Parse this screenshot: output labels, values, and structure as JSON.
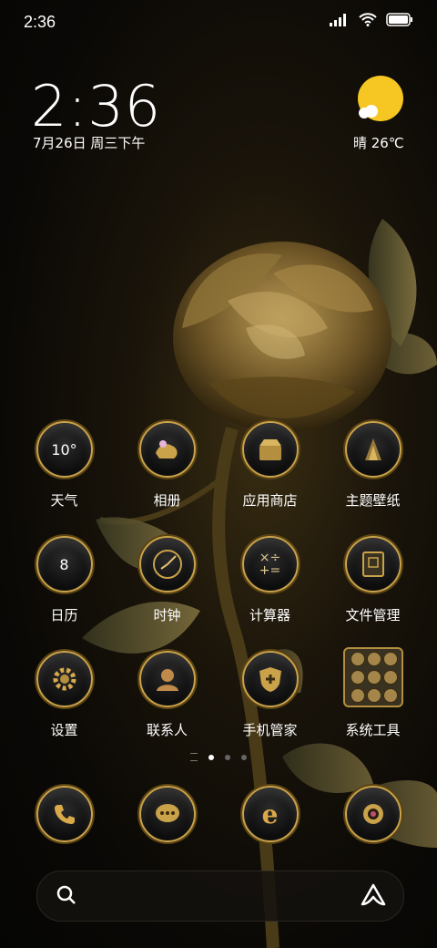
{
  "status_bar": {
    "time": "2:36"
  },
  "clock": {
    "time": "2:36",
    "date": "7月26日 周三下午"
  },
  "weather": {
    "text": "晴 26℃"
  },
  "apps": [
    {
      "label": "天气",
      "icon": "weather-icon",
      "badge": "10°"
    },
    {
      "label": "相册",
      "icon": "gallery-icon"
    },
    {
      "label": "应用商店",
      "icon": "app-store-icon"
    },
    {
      "label": "主题壁纸",
      "icon": "themes-icon"
    },
    {
      "label": "日历",
      "icon": "calendar-icon",
      "badge": "8"
    },
    {
      "label": "时钟",
      "icon": "clock-icon"
    },
    {
      "label": "计算器",
      "icon": "calculator-icon"
    },
    {
      "label": "文件管理",
      "icon": "file-manager-icon"
    },
    {
      "label": "设置",
      "icon": "settings-icon"
    },
    {
      "label": "联系人",
      "icon": "contacts-icon"
    },
    {
      "label": "手机管家",
      "icon": "security-icon"
    },
    {
      "label": "系统工具",
      "icon": "system-tools-folder-icon"
    }
  ],
  "dock": [
    {
      "icon": "phone-icon"
    },
    {
      "icon": "messages-icon"
    },
    {
      "icon": "browser-icon"
    },
    {
      "icon": "camera-icon"
    }
  ],
  "colors": {
    "gold": "#c9a24a",
    "sun": "#f6c623"
  }
}
